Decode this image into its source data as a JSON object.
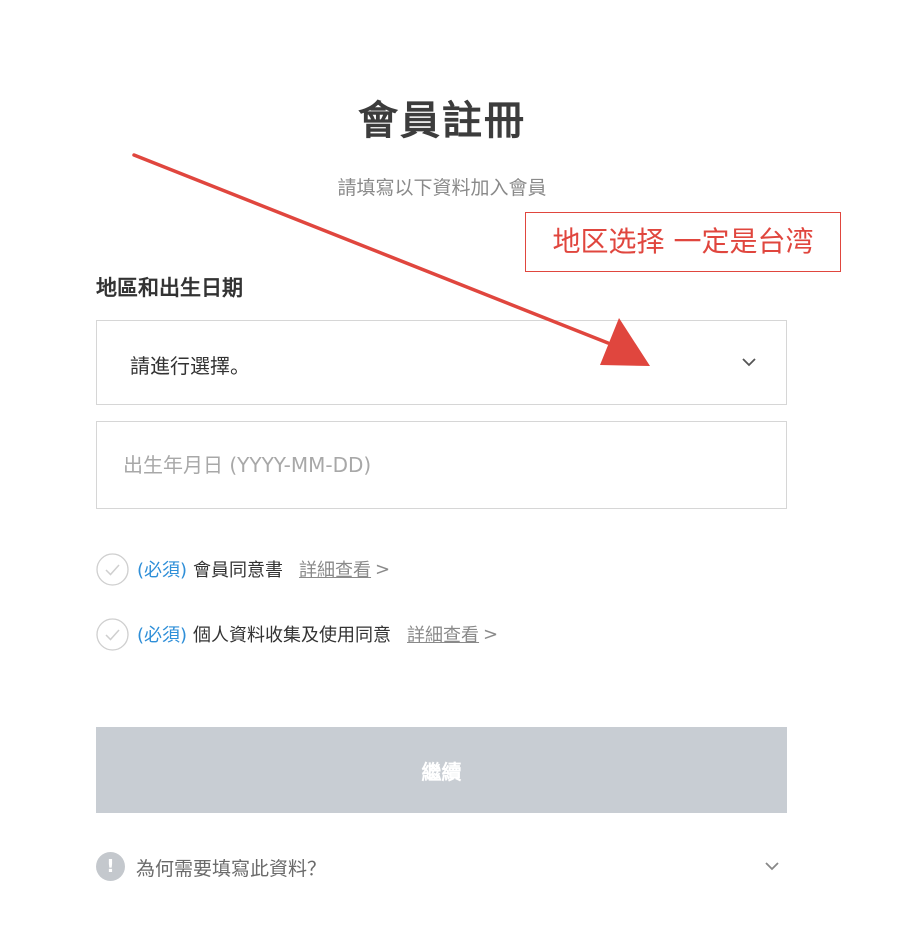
{
  "page": {
    "title": "會員註冊",
    "subtitle": "請填寫以下資料加入會員"
  },
  "annotation": {
    "text": "地区选择 一定是台湾",
    "color": "#e0463e"
  },
  "form": {
    "section_label": "地區和出生日期",
    "region_select": {
      "value": "請進行選擇。",
      "icon": "chevron-down-icon"
    },
    "birthdate_input": {
      "placeholder": "出生年月日 (YYYY-MM-DD)",
      "value": ""
    },
    "agreements": [
      {
        "required_tag": "(必須)",
        "label": "會員同意書",
        "link_text": "詳細查看",
        "link_chevron": ">"
      },
      {
        "required_tag": "(必須)",
        "label": "個人資料收集及使用同意",
        "link_text": "詳細查看",
        "link_chevron": ">"
      }
    ],
    "continue_label": "繼續"
  },
  "footer": {
    "info_glyph": "!",
    "why_text": "為何需要填寫此資料？"
  },
  "colors": {
    "accent_blue": "#2f8fd8",
    "button_disabled": "#c8cdd3",
    "annotation_red": "#e0463e"
  }
}
